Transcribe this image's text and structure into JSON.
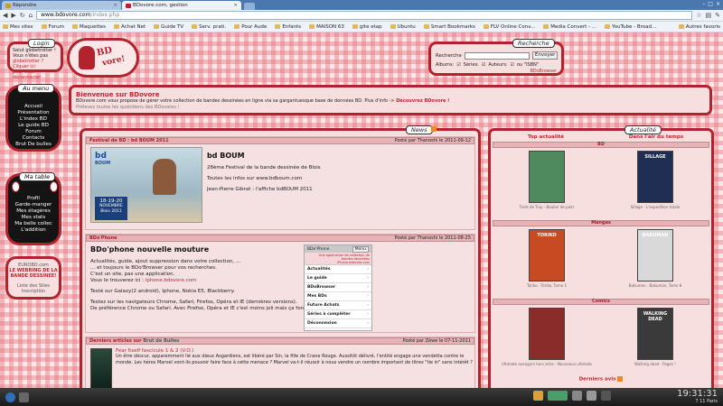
{
  "browser": {
    "tabs": [
      {
        "label": "Répondre"
      },
      {
        "label": "BDovore.com, gestion"
      }
    ],
    "url_host": "www.bdovore.com",
    "url_path": "/index.php",
    "bookmarks": [
      "Mes sites",
      "Forum",
      "Maquettes",
      "Achat Net",
      "Guide TV",
      "Serv. prati.",
      "Pour Aude",
      "Enfants",
      "MAISON 63",
      "gite etap",
      "Ubuntu",
      "Smart Bookmarks",
      "FLV Online Conv...",
      "Media Convert - ...",
      "YouTube - Broad..."
    ],
    "other_bookmarks": "Autres favoris"
  },
  "login": {
    "title": "Login",
    "l1": "Salut globetrotter !",
    "l2": "Vous n'êtes pas",
    "l3": "globetrotter ? Cliquer ici",
    "l4": "pour vous déconnecter"
  },
  "logo": {
    "bd": "BD",
    "vore": "vore!"
  },
  "menu": {
    "title": "Au menu",
    "items": [
      "Accueil",
      "Présentation",
      "L'index BD",
      "Le guide BD",
      "Forum",
      "Contacts",
      "Brut De bulles"
    ]
  },
  "matable": {
    "title": "Ma table",
    "items": [
      "Profil",
      "Garde-manger",
      "Mes étagères",
      "Mes stats",
      "Ma belle collec",
      "L'addition"
    ]
  },
  "eurobd": {
    "l1": "EUROBD.com",
    "l2": "LE WEBRING DE LA",
    "l3": "BANDE DESSINEE!",
    "l4": "Liste des Sites",
    "l5": "Inscription"
  },
  "search": {
    "title": "Recherche",
    "label": "Recherche",
    "button": "Envoyer",
    "albums": "Albums:",
    "series": "Séries:",
    "auteurs": "Auteurs:",
    "isbn": "ou \"ISBN\"",
    "browser": "BDoBrowser"
  },
  "welcome": {
    "title": "Bienvenue sur BDovore",
    "line1": "BDovore.com vous propose de gérer votre collection de bandes dessinées en ligne via sa gargantuesque base de données BD. Plus d'info ->",
    "link1": "Découvrez BDovore !",
    "line2": "Prélevez toutes les quotidiens des BDovores !"
  },
  "news": {
    "title": "News",
    "a1": {
      "header": "Festival de BD : bd BOUM 2011",
      "posted": "Posté par Thanoshi le 2011-09-12",
      "title": "bd BOUM",
      "l1": "28ème Festival de la bande dessinée de Blois",
      "l2": "Toutes les infos sur www.bdboum.com",
      "l3": "Jean-Pierre Gibrat : l'affiche bdBOUM 2011",
      "poster_t1": "bd",
      "poster_t2": "BOUM",
      "poster_date1": "18-19-20",
      "poster_date2": "NOVEMBRE",
      "poster_place": "Blois 2011"
    },
    "a2": {
      "header": "BDo'Phone",
      "posted": "Posté par Thanoshi le 2011-08-25",
      "title": "BDo'phone nouvelle mouture",
      "l1": "Actualités, guide, ajout suppression dans votre collection, ...",
      "l2": "... et toujours le BDo'Browser pour vos recherches.",
      "l3": "C'est un site, pas une application.",
      "l4": "Vous le trouverez ici :",
      "l4link": "iphone.bdovore.com",
      "l5": "Testé sur Galaxy(2 android), Iphone, Nokia E5, Blackberry.",
      "l6": "Testez sur les navigateurs Chrome, Safari, Firefox, Opéra et IE (dernières versions).",
      "l7": "De préférence Chrome ou Safari. Avec Firefox, Opéra et IE c'est moins joli mais ça fonctionne.",
      "phone": {
        "title": "BDo'Phone",
        "btn": "Menu",
        "banner": "Une application de collection de bandes dessinées",
        "url": "iPhone.bdovore.com",
        "items": [
          "Actualités",
          "Le guide",
          "BDoBrowser",
          "Mes BDs",
          "Future Achats",
          "Séries à compléter",
          "Déconnexion"
        ]
      }
    },
    "a3": {
      "header": "Derniers articles sur",
      "header_link": "Brut de Bulles",
      "posted": "Posté par Zéwe le 07-11-2011",
      "title": "Fear Itself fascicule 1 & 2 (V.O.)",
      "text": "Un être obscur, apparemment lié aux dieux Asgardiens, est libéré par Sin, la fille de Crane Rouge. Aussitôt délivré, l'entité engage une vendetta contre le monde. Les héros Marvel vont-ils pouvoir faire face à cette menace ? Marvel va-t-il réussir à nous vendre un nombre important de titres \"tie in\" sans intérêt ?"
    }
  },
  "actualite": {
    "title": "Actualité",
    "col1": "Top actualité",
    "col2": "Dans l'air du temps",
    "sections": [
      {
        "name": "BD",
        "items": [
          {
            "caption": "Trolls de Troy - Boulier de poils",
            "color": "#4f8a5f"
          },
          {
            "caption": "Sillage - L'expedition totale",
            "color": "#1f2e52",
            "text": "SILLAGE"
          }
        ]
      },
      {
        "name": "Mangas",
        "items": [
          {
            "caption": "Toriko - Toriko, Tome 1",
            "color": "#c84a22",
            "text": "TORIKO"
          },
          {
            "caption": "Bakuman - Bakuman, Tome 8",
            "color": "#d9d9d9",
            "text": "BAKUMAN"
          }
        ]
      },
      {
        "name": "Comics",
        "items": [
          {
            "caption": "Ultimate avengers hors série - Nouveaux ultimate",
            "color": "#8a2d2a"
          },
          {
            "caption": "Walking dead - Pages !",
            "color": "#3a3a3a",
            "text": "WALKING DEAD"
          }
        ]
      }
    ],
    "footer": "Derniers avis"
  },
  "taskbar": {
    "time": "19:31:31",
    "date": "7 11 Paris"
  }
}
